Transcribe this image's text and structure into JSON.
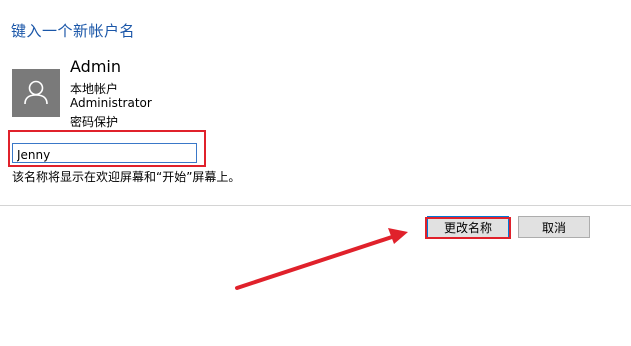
{
  "heading": "键入一个新帐户名",
  "account": {
    "avatar_icon": "user-icon",
    "name": "Admin",
    "type": "本地帐户",
    "group": "Administrator",
    "password_status": "密码保护"
  },
  "rename": {
    "input_value": "Jenny",
    "hint": "该名称将显示在欢迎屏幕和“开始”屏幕上。"
  },
  "buttons": {
    "rename_label": "更改名称",
    "cancel_label": "取消"
  },
  "colors": {
    "heading": "#1a56a8",
    "annotation": "#e0212b",
    "avatar_bg": "#7a7a7a",
    "input_border": "#3a78c8"
  }
}
